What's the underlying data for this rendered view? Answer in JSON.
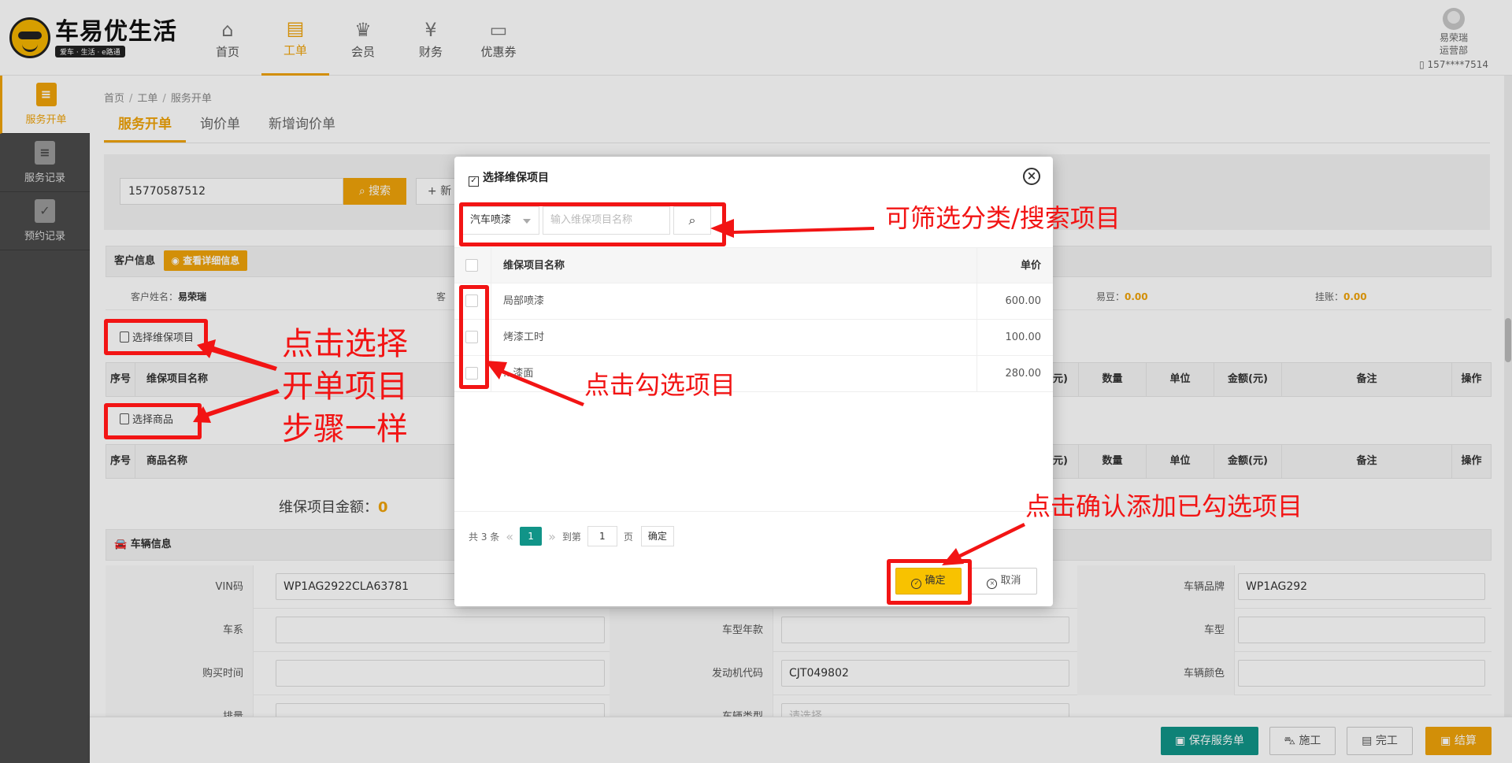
{
  "brand": {
    "title": "车易优生活",
    "subtitle": "爱车 · 生活 · e路通"
  },
  "nav": [
    {
      "label": "首页",
      "icon": "home-icon",
      "glyph": "⌂",
      "active": false
    },
    {
      "label": "工单",
      "icon": "clipboard-icon",
      "glyph": "▤",
      "active": true
    },
    {
      "label": "会员",
      "icon": "crown-icon",
      "glyph": "♛",
      "active": false
    },
    {
      "label": "财务",
      "icon": "finance-icon",
      "glyph": "¥",
      "active": false
    },
    {
      "label": "优惠券",
      "icon": "coupon-icon",
      "glyph": "▭",
      "active": false
    }
  ],
  "user": {
    "name": "易荣瑞",
    "dept": "运营部",
    "phone": "157****7514"
  },
  "sidebar": [
    {
      "label": "服务开单",
      "icon": "service-order-icon",
      "active": true
    },
    {
      "label": "服务记录",
      "icon": "service-record-icon",
      "active": false
    },
    {
      "label": "预约记录",
      "icon": "appointment-icon",
      "active": false
    }
  ],
  "breadcrumb": [
    "首页",
    "工单",
    "服务开单"
  ],
  "tabs": [
    {
      "label": "服务开单",
      "active": true
    },
    {
      "label": "询价单",
      "active": false
    },
    {
      "label": "新增询价单",
      "active": false
    }
  ],
  "search": {
    "value": "15770587512",
    "button": "搜索",
    "new_button": "+ 新"
  },
  "customer": {
    "title": "客户信息",
    "detail_button": "查看详细信息",
    "name_label": "客户姓名：",
    "name": "易荣瑞",
    "phone_label": "客",
    "beans_label": "易豆：",
    "beans": "0.00",
    "credit_label": "挂账：",
    "credit": "0.00"
  },
  "maintenance": {
    "select_button": "选择维保项目",
    "columns": [
      "序号",
      "维保项目名称",
      "价(元)",
      "数量",
      "单位",
      "金额(元)",
      "备注",
      "操作"
    ]
  },
  "goods": {
    "select_button": "选择商品",
    "columns": [
      "序号",
      "商品名称",
      "价(元)",
      "数量",
      "单位",
      "金额(元)",
      "备注",
      "操作"
    ]
  },
  "amount": {
    "label": "维保项目金额：",
    "value": "0"
  },
  "vehicle": {
    "title": "车辆信息",
    "rows": [
      [
        {
          "label": "VIN码",
          "value": "WP1AG2922CLA63781"
        },
        {
          "label": "",
          "value": ""
        },
        {
          "label": "车辆品牌",
          "value": "WP1AG292"
        }
      ],
      [
        {
          "label": "车系",
          "value": ""
        },
        {
          "label": "车型年款",
          "value": ""
        },
        {
          "label": "车型",
          "value": ""
        }
      ],
      [
        {
          "label": "购买时间",
          "value": ""
        },
        {
          "label": "发动机代码",
          "value": "CJT049802"
        },
        {
          "label": "车辆颜色",
          "value": ""
        }
      ],
      [
        {
          "label": "排量",
          "value": ""
        },
        {
          "label": "车辆类型",
          "value": "请选择"
        },
        {
          "label": "",
          "value": ""
        }
      ]
    ]
  },
  "bottom": {
    "save": "保存服务单",
    "construct": "施工",
    "finish": "完工",
    "settle": "结算"
  },
  "modal": {
    "title": "选择维保项目",
    "category": "汽车喷漆",
    "search_placeholder": "输入维保项目名称",
    "col_name": "维保项目名称",
    "col_price": "单价",
    "items": [
      {
        "name": "局部喷漆",
        "price": "600.00"
      },
      {
        "name": "烤漆工时",
        "price": "100.00"
      },
      {
        "name": "...漆面",
        "price": "280.00"
      }
    ],
    "pager": {
      "total": "共 3 条",
      "page": "1",
      "goto": "到第",
      "input": "1",
      "unit": "页",
      "confirm": "确定"
    },
    "ok": "确定",
    "cancel": "取消"
  },
  "annotations": {
    "filter": "可筛选分类/搜索项目",
    "step_line1": "点击选择",
    "step_line2": "开单项目",
    "step_line3": "步骤一样",
    "check": "点击勾选项目",
    "confirm": "点击确认添加已勾选项目"
  },
  "colors": {
    "accent": "#f0a30a",
    "primary_green": "#119488",
    "annotation_red": "#f21414",
    "sidebar_bg": "#4a4a4a"
  }
}
